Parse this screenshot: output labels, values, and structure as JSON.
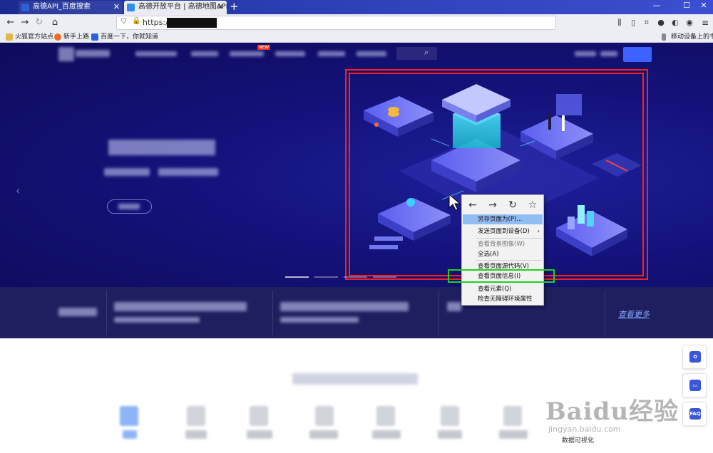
{
  "browser": {
    "tabs": [
      {
        "title": "高德API_百度搜索",
        "active": false
      },
      {
        "title": "高德开放平台 | 高德地图API",
        "active": true
      }
    ],
    "new_tab_label": "+",
    "url": "https://",
    "window_controls": {
      "minimize": "—",
      "maximize": "☐",
      "close": "✕"
    },
    "bookmarks": [
      {
        "label": "火狐官方站点"
      },
      {
        "label": "新手上路"
      },
      {
        "label": "百度一下，你就知道"
      }
    ],
    "mobile_bookmarks": "移动设备上的书签",
    "accent_color": "#2b3fb3"
  },
  "page": {
    "nav_new_badge": "NEW",
    "see_more": "查看更多",
    "feature_last_label": "数据可视化"
  },
  "side_buttons": [
    {
      "label": "",
      "icon": "gift-icon"
    },
    {
      "label": "",
      "icon": "chat-icon"
    },
    {
      "label": "FAQ",
      "icon": "faq-icon"
    }
  ],
  "context_menu": {
    "nav": {
      "back": "←",
      "forward": "→",
      "reload": "↻",
      "bookmark": "☆"
    },
    "items": [
      {
        "label": "另存页面为(P)...",
        "highlighted": true,
        "disabled": false
      },
      {
        "label": "发送页面到设备(D)",
        "submenu": "›"
      },
      {
        "label": "查看背景图像(W)",
        "disabled": true
      },
      {
        "label": "全选(A)"
      },
      {
        "label": "查看页面源代码(V)"
      },
      {
        "label": "查看页面信息(I)"
      },
      {
        "label": "查看元素(Q)"
      },
      {
        "label": "检查无障碍环境属性"
      }
    ]
  },
  "watermark": {
    "main": "Baidu经验",
    "sub": "jingyan.baidu.com"
  }
}
